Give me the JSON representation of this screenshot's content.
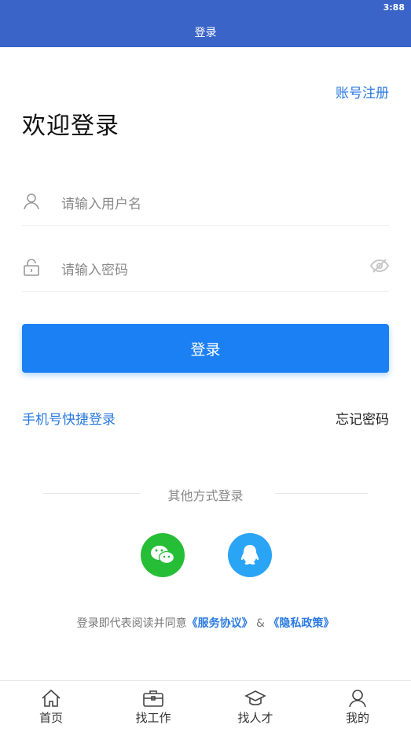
{
  "status_bar": {
    "time": "3:88"
  },
  "header": {
    "title": "登录"
  },
  "register_link": "账号注册",
  "welcome_title": "欢迎登录",
  "username": {
    "placeholder": "请输入用户名",
    "icon": "user-icon"
  },
  "password": {
    "placeholder": "请输入密码",
    "icon": "lock-icon",
    "toggle_icon": "eye-off-icon"
  },
  "login_button": "登录",
  "phone_login": "手机号快捷登录",
  "forgot_password": "忘记密码",
  "other_methods": "其他方式登录",
  "social": [
    {
      "name": "wechat",
      "icon": "wechat-icon",
      "color": "#27be37"
    },
    {
      "name": "qq",
      "icon": "qq-icon",
      "color": "#2aa4f4"
    }
  ],
  "agreement": {
    "prefix": "登录即代表阅读并同意",
    "service": "《服务协议》",
    "amp": " & ",
    "privacy": "《隐私政策》"
  },
  "tabbar": [
    {
      "label": "首页",
      "icon": "home-icon"
    },
    {
      "label": "找工作",
      "icon": "briefcase-icon"
    },
    {
      "label": "找人才",
      "icon": "graduation-cap-icon"
    },
    {
      "label": "我的",
      "icon": "profile-icon"
    }
  ],
  "colors": {
    "header": "#3a64c8",
    "primary": "#1b80f3",
    "link": "#2a7ae2"
  }
}
